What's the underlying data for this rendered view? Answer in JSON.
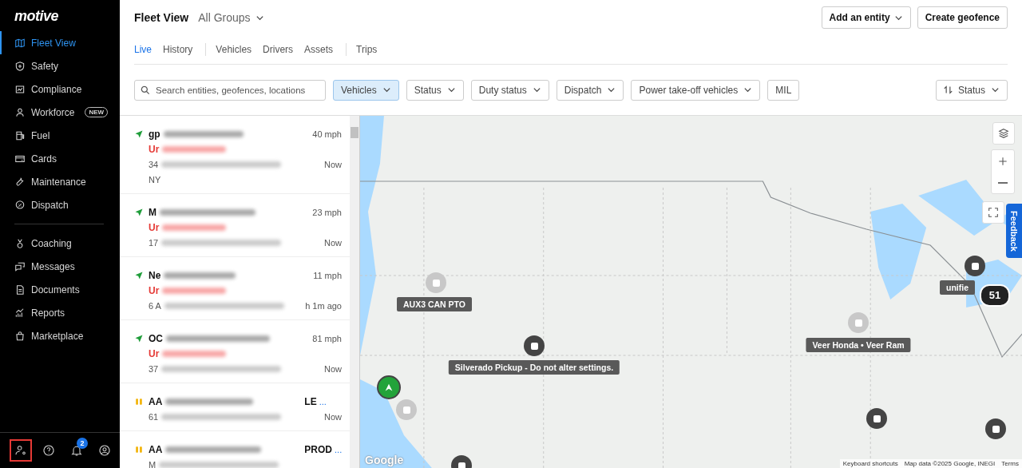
{
  "sidebar": {
    "logo": "motive",
    "items": [
      {
        "label": "Fleet View",
        "selected": true
      },
      {
        "label": "Safety",
        "selected": false
      },
      {
        "label": "Compliance",
        "selected": false
      },
      {
        "label": "Workforce",
        "selected": false,
        "badge": "NEW"
      },
      {
        "label": "Fuel",
        "selected": false
      },
      {
        "label": "Cards",
        "selected": false
      },
      {
        "label": "Maintenance",
        "selected": false
      },
      {
        "label": "Dispatch",
        "selected": false
      }
    ],
    "items_2": [
      {
        "label": "Coaching",
        "selected": false
      },
      {
        "label": "Messages",
        "selected": false
      },
      {
        "label": "Documents",
        "selected": false
      },
      {
        "label": "Reports",
        "selected": false
      },
      {
        "label": "Marketplace",
        "selected": false
      }
    ],
    "footer": [
      {
        "highlighted": true
      },
      {
        "highlighted": false
      },
      {
        "highlighted": false,
        "badge": "2"
      },
      {
        "highlighted": false
      }
    ]
  },
  "header": {
    "title": "Fleet View",
    "group": "All Groups",
    "buttons": [
      {
        "label": "Add an entity"
      },
      {
        "label": "Create geofence"
      }
    ]
  },
  "tabs": [
    {
      "label": "Live",
      "selected": true
    },
    {
      "label": "History",
      "selected": false
    },
    {
      "label": "Vehicles",
      "selected": false
    },
    {
      "label": "Drivers",
      "selected": false
    },
    {
      "label": "Assets",
      "selected": false
    },
    {
      "label": "Trips",
      "selected": false
    }
  ],
  "search": {
    "placeholder": "Search entities, geofences, locations"
  },
  "filters": [
    {
      "label": "Vehicles",
      "selected": true
    },
    {
      "label": "Status",
      "selected": false
    },
    {
      "label": "Duty status",
      "selected": false
    },
    {
      "label": "Dispatch",
      "selected": false
    },
    {
      "label": "Power take-off vehicles",
      "selected": false
    },
    {
      "label": "MIL",
      "selected": false
    }
  ],
  "sort": {
    "label": "Status"
  },
  "vehicles": [
    {
      "kind": "moving",
      "name": "gp",
      "status": "Ur",
      "address": "34",
      "address_2": "NY",
      "speed": "40 mph",
      "time": "Now"
    },
    {
      "kind": "moving",
      "name": "M",
      "status": "Ur",
      "address": "17",
      "speed": "23 mph",
      "time": "Now"
    },
    {
      "kind": "moving",
      "name": "Ne",
      "status": "Ur",
      "address": "6 A",
      "speed": "11 mph",
      "time": "h 1m ago"
    },
    {
      "kind": "moving",
      "name": "OC",
      "status": "Ur",
      "address": "37",
      "speed": "81 mph",
      "time": "Now"
    },
    {
      "kind": "paused",
      "name": "AA",
      "name_end": "LE",
      "ellipsis": "...",
      "address": "61",
      "time": "Now"
    },
    {
      "kind": "paused",
      "name": "AA",
      "name_end": "PROD",
      "ellipsis": "...",
      "address": "M"
    }
  ],
  "map": {
    "markers": [
      {
        "kind": "light"
      },
      {
        "kind": "dark"
      },
      {
        "kind": "light"
      },
      {
        "kind": "dark"
      },
      {
        "kind": "light"
      },
      {
        "kind": "green"
      },
      {
        "kind": "dark"
      },
      {
        "kind": "dark"
      },
      {
        "kind": "dark"
      }
    ],
    "labels": [
      "AUX3 CAN PTO",
      "Silverado Pickup - Do not alter settings.",
      "Veer Honda • Veer Ram",
      "unifie"
    ],
    "cluster": "51",
    "feedback": "Feedback",
    "google": "Google",
    "attribution": [
      "Keyboard shortcuts",
      "Map data ©2025 Google, INEGI",
      "Terms"
    ]
  }
}
